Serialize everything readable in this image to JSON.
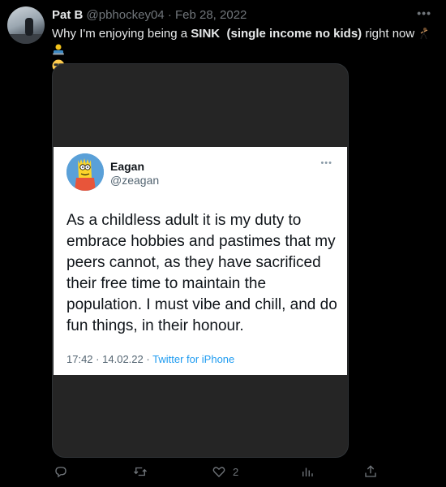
{
  "tweet": {
    "author_name": "Pat B",
    "handle": "@pbhockey04",
    "separator": "·",
    "date": "Feb 28, 2022",
    "text_pre": "Why I'm enjoying being a ",
    "text_bold": "SINK",
    "text_gap": "  ",
    "text_bold2": "(single income no kids)",
    "text_post": " right now"
  },
  "embedded": {
    "name": "Eagan",
    "handle": "@zeagan",
    "text": "As a childless adult it is my duty to embrace hobbies and pastimes that my peers cannot, as they have sacrificed their free time to maintain the population. I must vibe and chill, and do fun things, in their honour.",
    "time": "17:42",
    "dot": "·",
    "date": "14.02.22",
    "source": "Twitter for iPhone"
  },
  "actions": {
    "like_count": "2"
  },
  "icons": [
    "more-icon",
    "dancer-emoji",
    "person-laptop-emoji",
    "sunglasses-emoji",
    "reply-icon",
    "retweet-icon",
    "like-icon",
    "analytics-icon",
    "share-icon"
  ],
  "colors": {
    "background": "#000000",
    "text": "#e7e9ea",
    "muted": "#71767b",
    "link": "#1d9bf0"
  }
}
